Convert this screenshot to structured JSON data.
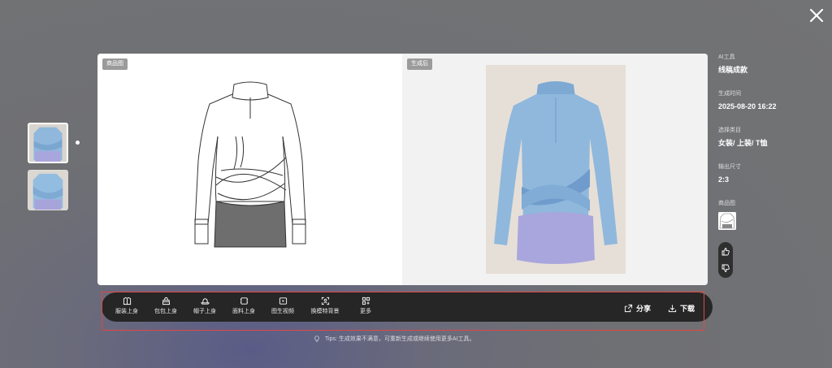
{
  "thumbnails": [
    {
      "name": "result-1",
      "active": true
    },
    {
      "name": "result-2",
      "active": false
    }
  ],
  "canvas": {
    "left_tag": "商品图",
    "right_tag": "生成后"
  },
  "info": {
    "tool_label": "AI工具",
    "tool_value": "线稿成款",
    "time_label": "生成时间",
    "time_value": "2025-08-20 16:22",
    "category_label": "选择类目",
    "category_value": "女装/ 上装/ T恤",
    "size_label": "输出尺寸",
    "size_value": "2:3",
    "product_label": "商品图"
  },
  "toolbar": {
    "tools": [
      {
        "label": "服装上身",
        "icon": "shirt-icon"
      },
      {
        "label": "包包上身",
        "icon": "bag-icon"
      },
      {
        "label": "帽子上身",
        "icon": "hat-icon"
      },
      {
        "label": "面料上身",
        "icon": "fabric-icon"
      },
      {
        "label": "图生视频",
        "icon": "video-icon"
      },
      {
        "label": "换模特背景",
        "icon": "scan-icon"
      },
      {
        "label": "更多",
        "icon": "grid-icon"
      }
    ],
    "share_label": "分享",
    "download_label": "下载"
  },
  "tips": "Tips: 生成效果不满意，可重新生成或继续使用更多AI工具。",
  "colors": {
    "toolbar_bg": "#262626",
    "highlight_outline": "#e54545",
    "tag_bg": "#9b9b9b",
    "garment_blue": "#8fb8dc",
    "garment_lavender": "#a9a6dd"
  }
}
